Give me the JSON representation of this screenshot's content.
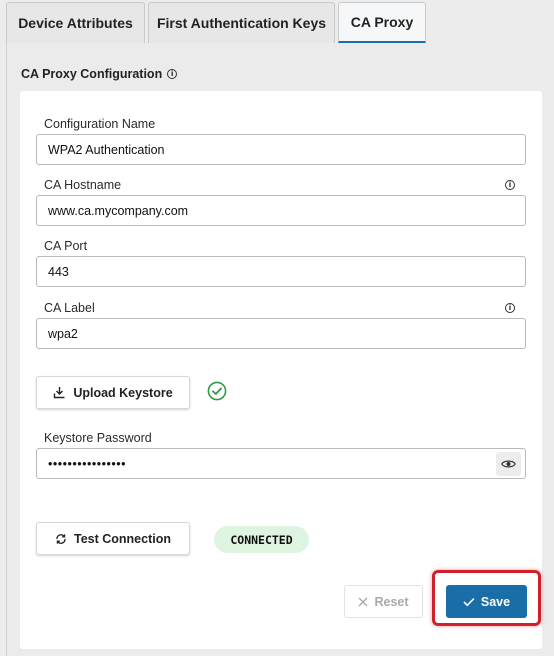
{
  "tabs": [
    {
      "label": "Device Attributes",
      "active": false
    },
    {
      "label": "First Authentication Keys",
      "active": false
    },
    {
      "label": "CA Proxy",
      "active": true
    }
  ],
  "section": {
    "title": "CA Proxy Configuration",
    "info_icon": "info-circle-icon"
  },
  "fields": {
    "config_name": {
      "label": "Configuration Name",
      "value": "WPA2 Authentication"
    },
    "ca_hostname": {
      "label": "CA Hostname",
      "value": "www.ca.mycompany.com"
    },
    "ca_port": {
      "label": "CA Port",
      "value": "443"
    },
    "ca_label": {
      "label": "CA Label",
      "value": "wpa2"
    },
    "keystore_password": {
      "label": "Keystore Password",
      "value": "••••••••••••••••"
    }
  },
  "buttons": {
    "upload_keystore": "Upload Keystore",
    "test_connection": "Test Connection",
    "reset": "Reset",
    "save": "Save"
  },
  "status": {
    "connection": "CONNECTED",
    "keystore_uploaded": true
  },
  "colors": {
    "accent": "#1a6ea8",
    "success": "#2e9b45",
    "status_bg": "#dff3e1",
    "highlight": "#d0202b"
  }
}
